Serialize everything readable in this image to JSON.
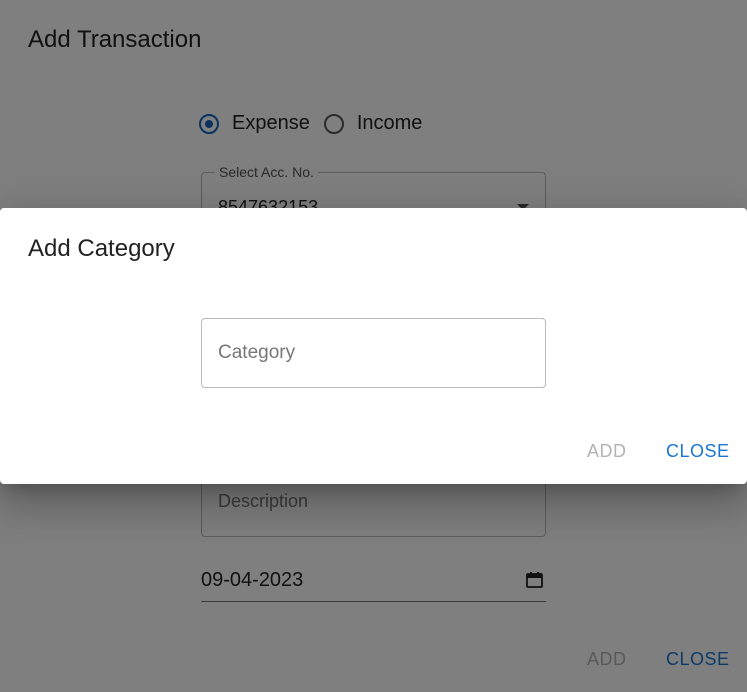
{
  "background_dialog": {
    "title": "Add Transaction",
    "type_options": [
      {
        "label": "Expense",
        "selected": true
      },
      {
        "label": "Income",
        "selected": false
      }
    ],
    "account_field": {
      "label": "Select Acc. No.",
      "value": "8547632153"
    },
    "description_field": {
      "placeholder": "Description"
    },
    "date_field": {
      "value": "09-04-2023"
    },
    "actions": {
      "add_label": "ADD",
      "close_label": "CLOSE"
    }
  },
  "modal": {
    "title": "Add Category",
    "category_input": {
      "placeholder": "Category",
      "value": ""
    },
    "actions": {
      "add_label": "ADD",
      "close_label": "CLOSE"
    }
  },
  "colors": {
    "accent": "#1976d2",
    "radio_selected": "#1565c0",
    "disabled": "#b3b3b3",
    "backdrop": "rgba(0,0,0,0.5)"
  }
}
